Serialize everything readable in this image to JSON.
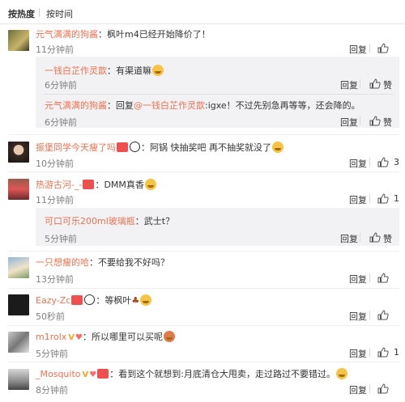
{
  "sort": {
    "hot": "按热度",
    "time": "按时间"
  },
  "actions": {
    "reply": "回复",
    "like": "赞"
  },
  "colors": {
    "username": "#eb7350",
    "subbox": "#f2f2f5",
    "time": "#808080"
  },
  "comments": [
    {
      "user": "元气满满的狗酱",
      "text": "：枫叶m4已经开始降价了！",
      "time": "11分钟前",
      "likes": "",
      "replies": [
        {
          "user": "一钱白芷作灵歆",
          "text": "：有渠道嘛",
          "emoji": "smile-emoji",
          "time": "6分钟前",
          "likes": ""
        },
        {
          "user": "元气满满的狗酱",
          "text": "：回复",
          "mention": "@一钱白芷作灵歆",
          "text2": ":igxe！不过先别急再等等，还会降的。",
          "time": "6分钟前",
          "likes": ""
        }
      ]
    },
    {
      "user": "振堡同学今天瘦了吗",
      "text": "：阿锅 快抽奖吧 再不抽奖就没了",
      "emoji": "doge-emoji",
      "time": "10分钟前",
      "likes": "3"
    },
    {
      "user": "热游古河-_-",
      "text": "：DMM真香",
      "emoji": "doge-emoji",
      "time": "11分钟前",
      "likes": "1",
      "replies": [
        {
          "user": "可口可乐200ml玻璃瓶",
          "text": "：武士t？",
          "time": "5分钟前",
          "likes": ""
        }
      ]
    },
    {
      "user": "一只想瘦的哈",
      "text": "：不要给我不好吗？",
      "time": "13分钟前",
      "likes": ""
    },
    {
      "user": "Eazy-Zc",
      "text": "：等枫叶",
      "emoji": "laugh-emoji",
      "time": "50秒前",
      "likes": ""
    },
    {
      "user": "m1rolx",
      "text": "：所以哪里可以买呢",
      "emoji": "confused-emoji",
      "time": "5分钟前",
      "likes": "1"
    },
    {
      "user": "_Mosquito",
      "text": "：看到这个就想到:月底清仓大甩卖，走过路过不要错过。",
      "emoji": "laugh-emoji",
      "time": "8分钟前",
      "likes": ""
    }
  ]
}
